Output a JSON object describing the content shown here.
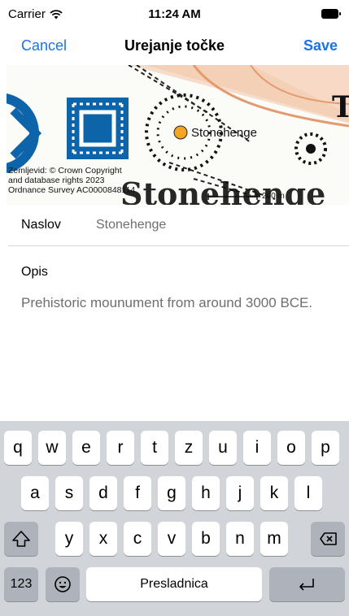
{
  "status_bar": {
    "carrier": "Carrier",
    "time": "11:24 AM"
  },
  "nav": {
    "cancel_label": "Cancel",
    "title": "Urejanje točke",
    "save_label": "Save"
  },
  "map": {
    "place_label": "Stonehenge",
    "attribution": [
      "Zemljevid: © Crown Copyright",
      "and database rights 2023",
      "Ordnance Survey AC0000848114"
    ],
    "scale_label": "200 m"
  },
  "form": {
    "title_label": "Naslov",
    "title_value": "Stonehenge",
    "description_label": "Opis",
    "description_value": "Prehistoric mounument from around 3000 BCE."
  },
  "keyboard": {
    "row1": [
      "q",
      "w",
      "e",
      "r",
      "t",
      "z",
      "u",
      "i",
      "o",
      "p"
    ],
    "row2": [
      "a",
      "s",
      "d",
      "f",
      "g",
      "h",
      "j",
      "k",
      "l"
    ],
    "row3": [
      "y",
      "x",
      "c",
      "v",
      "b",
      "n",
      "m"
    ],
    "numbers_key": "123",
    "space_label": "Presladnica",
    "shift_icon": "shift-icon",
    "delete_icon": "delete-icon",
    "emoji_icon": "emoji-icon",
    "return_icon": "return-icon"
  }
}
